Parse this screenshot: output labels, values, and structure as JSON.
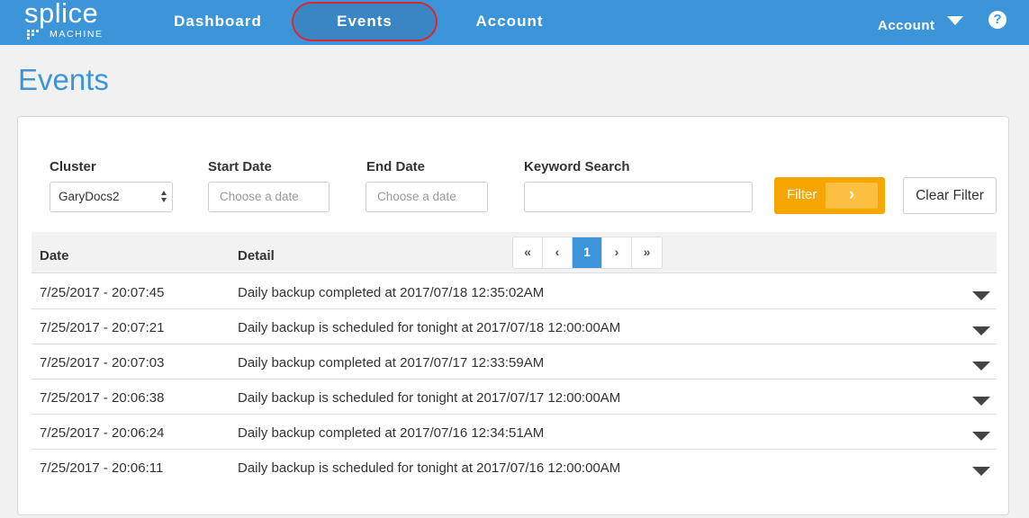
{
  "brand": {
    "name": "splice",
    "sub": "MACHINE"
  },
  "nav": {
    "items": [
      "Dashboard",
      "Events",
      "Account"
    ],
    "active": "Events",
    "account_label": "Account",
    "help_glyph": "?"
  },
  "page": {
    "title": "Events"
  },
  "filters": {
    "cluster_label": "Cluster",
    "cluster_value": "GaryDocs2",
    "start_label": "Start Date",
    "start_placeholder": "Choose a date",
    "end_label": "End Date",
    "end_placeholder": "Choose a date",
    "keyword_label": "Keyword Search",
    "keyword_value": "",
    "filter_button": "Filter",
    "clear_button": "Clear Filter"
  },
  "table": {
    "columns": [
      "Date",
      "Detail"
    ],
    "pager": [
      "«",
      "‹",
      "1",
      "›",
      "»"
    ],
    "current_page": "1",
    "rows": [
      {
        "date": "7/25/2017 - 20:07:45",
        "detail": "Daily backup completed at 2017/07/18 12:35:02AM"
      },
      {
        "date": "7/25/2017 - 20:07:21",
        "detail": "Daily backup is scheduled for tonight at 2017/07/18 12:00:00AM"
      },
      {
        "date": "7/25/2017 - 20:07:03",
        "detail": "Daily backup completed at 2017/07/17 12:33:59AM"
      },
      {
        "date": "7/25/2017 - 20:06:38",
        "detail": "Daily backup is scheduled for tonight at 2017/07/17 12:00:00AM"
      },
      {
        "date": "7/25/2017 - 20:06:24",
        "detail": "Daily backup completed at 2017/07/16 12:34:51AM"
      },
      {
        "date": "7/25/2017 - 20:06:11",
        "detail": "Daily backup is scheduled for tonight at 2017/07/16 12:00:00AM"
      }
    ]
  },
  "colors": {
    "brand_blue": "#3d95d9",
    "filter_orange": "#f7a600",
    "highlight_red": "#e0262b"
  }
}
